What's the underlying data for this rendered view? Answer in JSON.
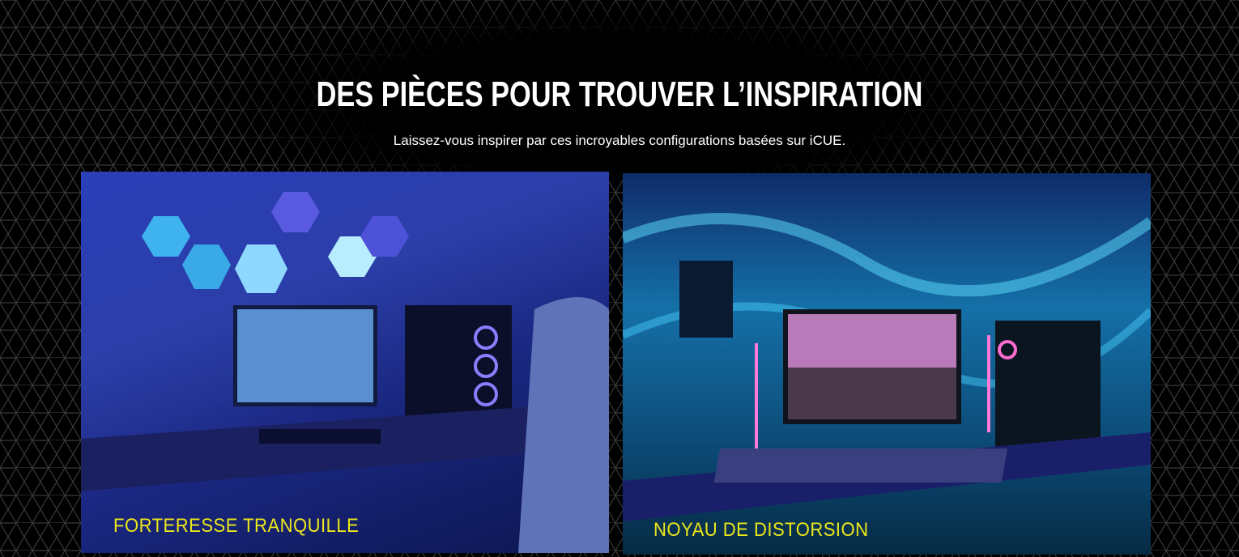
{
  "section": {
    "title": "DES PIÈCES POUR TROUVER L’INSPIRATION",
    "subtitle": "Laissez-vous inspirer par ces incroyables configurations basées sur iCUE."
  },
  "cards": [
    {
      "label": "FORTERESSE TRANQUILLE"
    },
    {
      "label": "NOYAU DE DISTORSION"
    }
  ],
  "colors": {
    "background": "#000000",
    "label": "#ece71a",
    "title": "#ffffff"
  }
}
